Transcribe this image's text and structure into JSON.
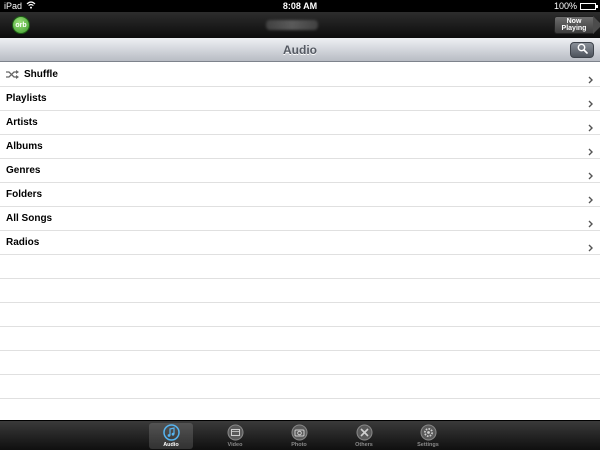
{
  "status_bar": {
    "device": "iPad",
    "time": "8:08 AM",
    "battery": "100%"
  },
  "header": {
    "logo_text": "orb",
    "now_playing_line1": "Now",
    "now_playing_line2": "Playing"
  },
  "navbar": {
    "title": "Audio"
  },
  "list": {
    "items": [
      {
        "label": "Shuffle",
        "icon": "shuffle-icon"
      },
      {
        "label": "Playlists"
      },
      {
        "label": "Artists"
      },
      {
        "label": "Albums"
      },
      {
        "label": "Genres"
      },
      {
        "label": "Folders"
      },
      {
        "label": "All Songs"
      },
      {
        "label": "Radios"
      }
    ]
  },
  "tabbar": {
    "tabs": [
      {
        "label": "Audio",
        "icon": "music-note-icon",
        "active": true
      },
      {
        "label": "Video",
        "icon": "film-icon",
        "active": false
      },
      {
        "label": "Photo",
        "icon": "camera-icon",
        "active": false
      },
      {
        "label": "Others",
        "icon": "tools-icon",
        "active": false
      },
      {
        "label": "Settings",
        "icon": "gear-icon",
        "active": false
      }
    ]
  },
  "colors": {
    "active_tab_icon": "#56b4f0",
    "navbar_title": "#555a63",
    "logo_green": "#3b9a2b"
  }
}
